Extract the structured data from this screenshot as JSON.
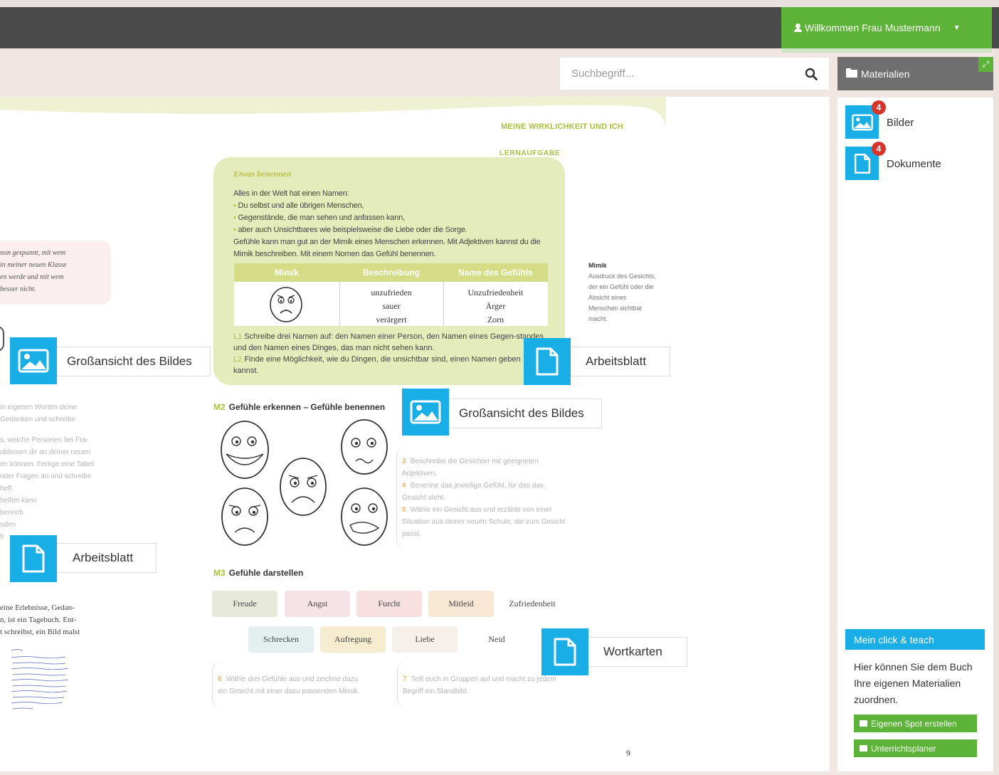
{
  "topbar": {
    "user_label": "Willkommen Frau Mustermann"
  },
  "search": {
    "placeholder": "Suchbegriff..."
  },
  "book": {
    "chapter_title": "MEINE WIRKLICHKEIT UND ICH",
    "task_tag": "LERNAUFGABE",
    "box": {
      "title": "Etwas benennen",
      "intro": "Alles in der Welt hat einen Namen:",
      "bullets": [
        "Du selbst und alle übrigen Menschen,",
        "Gegenstände, die man sehen und anfassen kann,",
        "aber auch Unsichtbares wie beispielsweise die Liebe oder die Sorge."
      ],
      "explanation": "Gefühle kann man gut an der Mimik eines Menschen erkennen. Mit Adjektiven kannst du die Mimik beschreiben. Mit einem Nomen das Gefühl benennen.",
      "table": {
        "headers": [
          "Mimik",
          "Beschreibung",
          "Name des Gefühls"
        ],
        "beschreibung": [
          "unzufrieden",
          "sauer",
          "verärgert"
        ],
        "namen": [
          "Unzufriedenheit",
          "Ärger",
          "Zorn"
        ]
      },
      "tasks": [
        {
          "num": "L1",
          "text": "Schreibe drei Namen auf: den Namen einer Person, den Namen eines Gegen-standes und den Namen eines Dinges, das man nicht sehen kann."
        },
        {
          "num": "L2",
          "text": "Finde eine Möglichkeit, wie du Dingen, die unsichtbar sind, einen Namen geben kannst."
        }
      ]
    },
    "glossary": {
      "term": "Mimik",
      "definition": "Ausdruck des Gesichts, der ein Gefühl oder die Absicht eines Menschen sichtbar macht."
    },
    "m2": {
      "num": "M2",
      "title": "Gefühle erkennen – Gefühle benennen"
    },
    "m2_tasks": [
      {
        "num": "3",
        "text": "Beschreibe die Gesichter mit geeigneten Adjektiven."
      },
      {
        "num": "4",
        "text": "Benenne das jeweilige Gefühl, für das das Gesicht steht."
      },
      {
        "num": "5",
        "text": "Wähle ein Gesicht aus und erzähle von einer Situation aus deiner neuen Schule, die zum Gesicht passt."
      }
    ],
    "m3": {
      "num": "M3",
      "title": "Gefühle darstellen"
    },
    "chips_row1": [
      "Freude",
      "Angst",
      "Furcht",
      "Mitleid",
      "Zufriedenheit"
    ],
    "chips_row2": [
      "Schrecken",
      "Aufregung",
      "Liebe",
      "Neid"
    ],
    "chip_colors": {
      "Freude": "#e8ead9",
      "Angst": "#f6e3e6",
      "Furcht": "#f8dfe0",
      "Mitleid": "#f7e7d4",
      "Zufriedenheit": "#ffffff",
      "Schrecken": "#e4f0ef",
      "Aufregung": "#f6ecd0",
      "Liebe": "#f7efe9",
      "Neid": "#ffffff"
    },
    "m3_tasks": [
      {
        "num": "6",
        "text": "Wähle drei Gefühle aus und zeichne dazu ein Gesicht mit einer dazu passenden Mimik."
      },
      {
        "num": "7",
        "text": "Teilt euch in Gruppen auf und macht zu jedem Begriff ein Standbild."
      }
    ],
    "left_bubble": [
      "non gespannt, mit wem",
      "in meiner neuen Klasse",
      "en werde und mit wem",
      "besser nicht."
    ],
    "left_faded": [
      "in eigenen Worten deine",
      "Gedanken und schreibe",
      "",
      "s, welche Personen bei Fra-",
      "oblemen dir an deiner neuen",
      "en können. Fertige eine Tabel",
      "nder Fragen an und schreibe",
      "heft.",
      "helfen kann",
      "bereich",
      "nden",
      "fr"
    ],
    "left_bottom": [
      "eine Erlebnisse, Gedan-",
      "n, ist ein Tagebuch. Ent-",
      "t schreibst, ein Bild malst"
    ],
    "page_number": "9"
  },
  "overlays": {
    "grossansicht_left": "Großansicht des Bildes",
    "arbeitsblatt_right": "Arbeitsblatt",
    "grossansicht_center": "Großansicht des Bildes",
    "arbeitsblatt_left": "Arbeitsblatt",
    "wortkarten": "Wortkarten"
  },
  "sidebar": {
    "title": "Materialien",
    "items": [
      {
        "label": "Bilder",
        "count": "4",
        "icon": "image-icon"
      },
      {
        "label": "Dokumente",
        "count": "4",
        "icon": "document-icon"
      }
    ],
    "click_teach": {
      "title": "Mein click & teach",
      "text": "Hier können Sie dem Buch Ihre eigenen Materialien zuordnen.",
      "btn_spot": "Eigenen Spot erstellen",
      "btn_planer": "Unterrichtsplaner"
    }
  },
  "colors": {
    "accent_blue": "#19aee6",
    "accent_green": "#5cb338",
    "book_green": "#a9c23a",
    "badge_red": "#d9342b"
  }
}
